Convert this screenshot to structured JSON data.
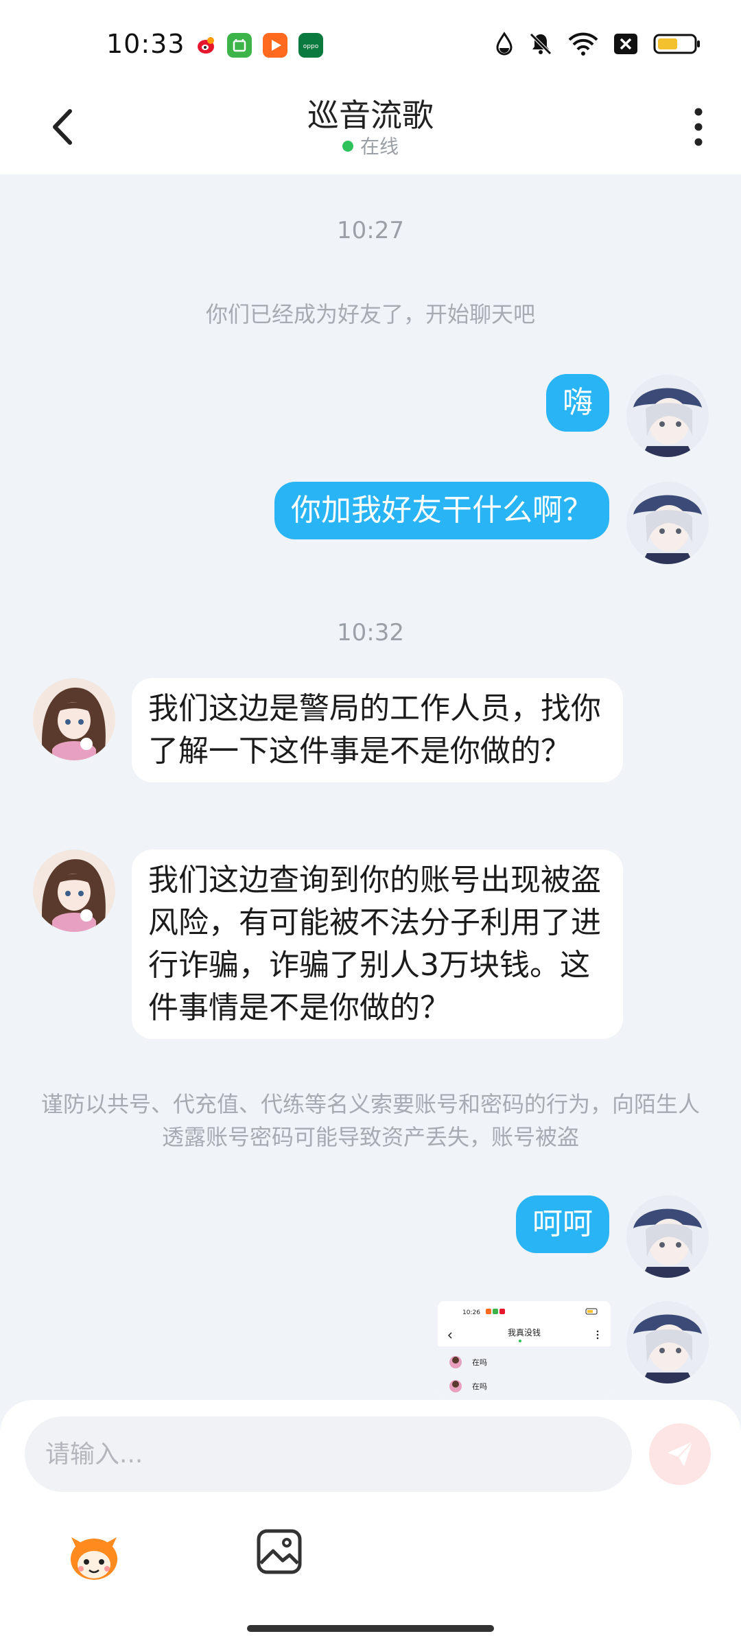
{
  "status_bar": {
    "time": "10:33",
    "icons": [
      "weibo-app-icon",
      "green-app-icon",
      "video-app-icon",
      "oppo-app-icon",
      "data-saver-icon",
      "mute-icon",
      "wifi-icon",
      "no-sim-icon",
      "battery-icon"
    ],
    "app_icon_label": "oppo"
  },
  "header": {
    "title": "巡音流歌",
    "status": "在线"
  },
  "messages": {
    "time1": "10:27",
    "system1": "你们已经成为好友了，开始聊天吧",
    "out1": "嗨",
    "out2": "你加我好友干什么啊？",
    "time2": "10:32",
    "in1": "我们这边是警局的工作人员，找你了解一下这件事是不是你做的？",
    "in2": "我们这边查询到你的账号出现被盗风险，有可能被不法分子利用了进行诈骗，诈骗了别人3万块钱。这件事情是不是你做的？",
    "system2": "谨防以共号、代充值、代练等名义索要账号和密码的行为，向陌生人透露账号密码可能导致资产丢失，账号被盗",
    "out3": "呵呵",
    "image_msg": {
      "time": "10:26",
      "title": "我真没钱",
      "line1": "在吗",
      "line2": "在吗"
    }
  },
  "input": {
    "placeholder": "请输入..."
  },
  "colors": {
    "outgoing_bubble": "#29b4f5",
    "incoming_bubble": "#ffffff",
    "chat_background": "#f0f3f8",
    "online_dot": "#2ec25a",
    "send_button": "#fde5e5"
  }
}
